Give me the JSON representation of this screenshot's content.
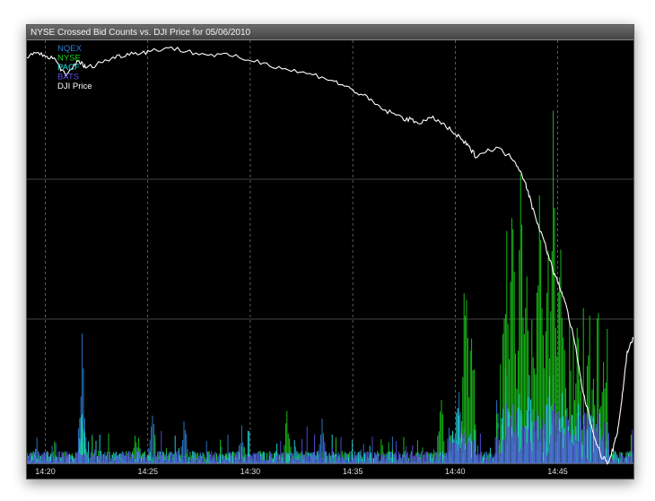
{
  "window": {
    "title": "NYSE Crossed Bid Counts vs. DJI Price for 05/06/2010"
  },
  "chart_data": {
    "type": "line",
    "title": "NYSE Crossed Bid Counts vs. DJI Price for 05/06/2010",
    "x_ticks": [
      "14:20",
      "14:25",
      "14:30",
      "14:35",
      "14:40",
      "14:45"
    ],
    "x_tick_minutes": [
      0,
      5,
      10,
      15,
      20,
      25
    ],
    "x_range_minutes": [
      -0.9,
      28.7
    ],
    "grid": true,
    "legend_position": "top-left",
    "series": [
      {
        "name": "NQEX",
        "color": "#2f7fd6",
        "kind": "counts",
        "spikes": [
          [
            1.8,
            0.33
          ],
          [
            5.2,
            0.15
          ],
          [
            6.8,
            0.12
          ],
          [
            9.6,
            0.1
          ],
          [
            13.5,
            0.14
          ],
          [
            20.2,
            0.2
          ],
          [
            22.5,
            0.3
          ],
          [
            24.8,
            0.28
          ],
          [
            26.0,
            0.14
          ]
        ]
      },
      {
        "name": "NYSE",
        "color": "#19d119",
        "kind": "counts",
        "spikes": [
          [
            1.8,
            0.1
          ],
          [
            4.4,
            0.08
          ],
          [
            11.8,
            0.14
          ],
          [
            19.3,
            0.2
          ],
          [
            20.5,
            0.57
          ],
          [
            20.8,
            0.45
          ],
          [
            22.5,
            0.64
          ],
          [
            22.8,
            0.75
          ],
          [
            23.2,
            0.81
          ],
          [
            23.5,
            0.6
          ],
          [
            24.1,
            0.83
          ],
          [
            24.5,
            0.67
          ],
          [
            24.8,
            0.91
          ],
          [
            25.1,
            0.7
          ],
          [
            25.3,
            0.4
          ],
          [
            25.9,
            0.3
          ]
        ]
      },
      {
        "name": "PACF",
        "color": "#24e0e0",
        "kind": "counts",
        "spikes": [
          [
            1.8,
            0.16
          ],
          [
            20.1,
            0.18
          ],
          [
            23.6,
            0.28
          ],
          [
            24.6,
            0.22
          ],
          [
            25.2,
            0.21
          ],
          [
            26.1,
            0.12
          ]
        ]
      },
      {
        "name": "BATS",
        "color": "#5a4ee0",
        "kind": "counts",
        "spikes": [
          [
            1.6,
            0.05
          ],
          [
            20.0,
            0.08
          ],
          [
            24.0,
            0.12
          ],
          [
            25.5,
            0.1
          ]
        ]
      },
      {
        "name": "DJI Price",
        "color": "#ffffff",
        "kind": "price",
        "points": [
          [
            -0.9,
            0.98
          ],
          [
            -0.2,
            0.985
          ],
          [
            0.5,
            0.97
          ],
          [
            1.0,
            0.93
          ],
          [
            1.6,
            0.97
          ],
          [
            2.0,
            0.95
          ],
          [
            3.0,
            0.97
          ],
          [
            4.0,
            0.985
          ],
          [
            5.0,
            0.99
          ],
          [
            6.0,
            1.0
          ],
          [
            7.5,
            0.985
          ],
          [
            9.0,
            0.98
          ],
          [
            10.5,
            0.965
          ],
          [
            12.0,
            0.945
          ],
          [
            13.5,
            0.93
          ],
          [
            14.5,
            0.91
          ],
          [
            15.5,
            0.885
          ],
          [
            16.5,
            0.85
          ],
          [
            17.5,
            0.83
          ],
          [
            18.2,
            0.82
          ],
          [
            19.0,
            0.83
          ],
          [
            19.8,
            0.8
          ],
          [
            20.5,
            0.77
          ],
          [
            21.0,
            0.74
          ],
          [
            22.0,
            0.76
          ],
          [
            22.9,
            0.73
          ],
          [
            23.4,
            0.68
          ],
          [
            23.8,
            0.61
          ],
          [
            24.3,
            0.54
          ],
          [
            24.8,
            0.46
          ],
          [
            25.3,
            0.4
          ],
          [
            25.8,
            0.3
          ],
          [
            26.2,
            0.18
          ],
          [
            26.7,
            0.08
          ],
          [
            27.1,
            0.02
          ],
          [
            27.5,
            0.0
          ],
          [
            27.9,
            0.07
          ],
          [
            28.1,
            0.14
          ],
          [
            28.4,
            0.27
          ],
          [
            28.7,
            0.3
          ]
        ]
      }
    ]
  }
}
